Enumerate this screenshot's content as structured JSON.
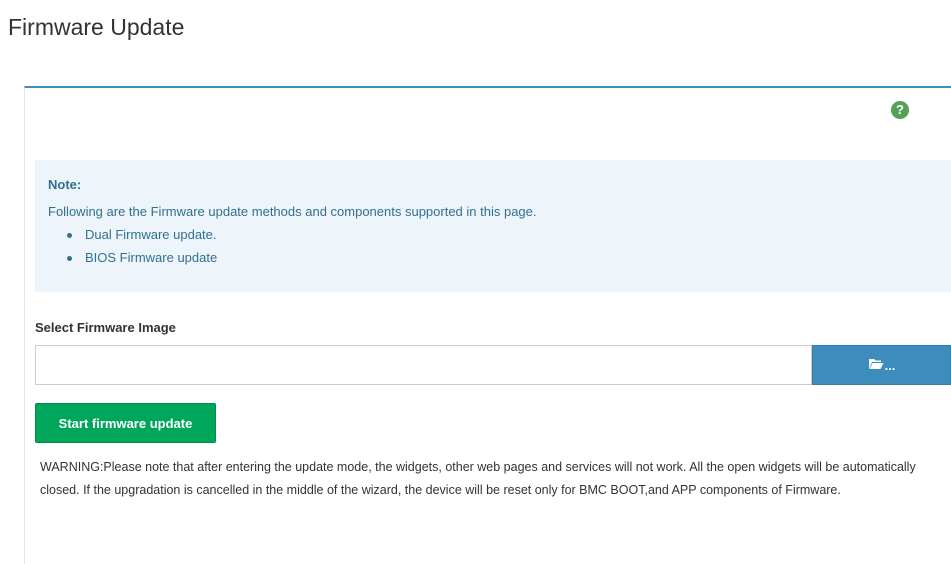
{
  "page": {
    "title": "Firmware Update"
  },
  "help": {
    "icon": "question-circle-icon",
    "glyph": "?"
  },
  "note": {
    "title": "Note:",
    "text": "Following are the Firmware update methods and components supported in this page.",
    "items": [
      "Dual Firmware update.",
      "BIOS Firmware update"
    ]
  },
  "firmware_image": {
    "label": "Select Firmware Image",
    "value": "",
    "placeholder": "",
    "browse_icon": "folder-open-icon",
    "browse_suffix": "..."
  },
  "actions": {
    "start_label": "Start firmware update"
  },
  "warning": {
    "prefix": "WARNING:",
    "text": "Please note that after entering the update mode, the widgets, other web pages and services will not work. All the open widgets will be automatically closed. If the upgradation is cancelled in the middle of the wizard, the device will be reset only for BMC BOOT,and APP components of Firmware."
  },
  "colors": {
    "panel_accent": "#3c8dbc",
    "note_background": "#edf5fb",
    "note_text": "#31708f",
    "browse_button": "#3c8dbc",
    "start_button": "#00a65a",
    "help_icon": "#54a155"
  }
}
